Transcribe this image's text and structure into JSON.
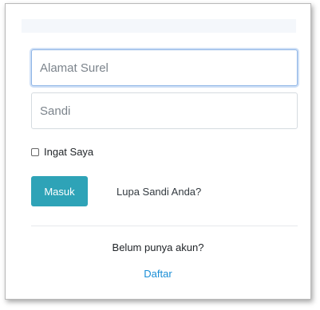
{
  "login_form": {
    "email_placeholder": "Alamat Surel",
    "password_placeholder": "Sandi",
    "remember_label": "Ingat Saya",
    "remember_checked": false,
    "login_button": "Masuk",
    "forgot_password_link": "Lupa Sandi Anda?"
  },
  "register": {
    "prompt": "Belum punya akun?",
    "link": "Daftar"
  },
  "colors": {
    "button_accent": "#2ea3b7",
    "link": "#1a8ed6",
    "focus_border": "#8fb5e6"
  }
}
